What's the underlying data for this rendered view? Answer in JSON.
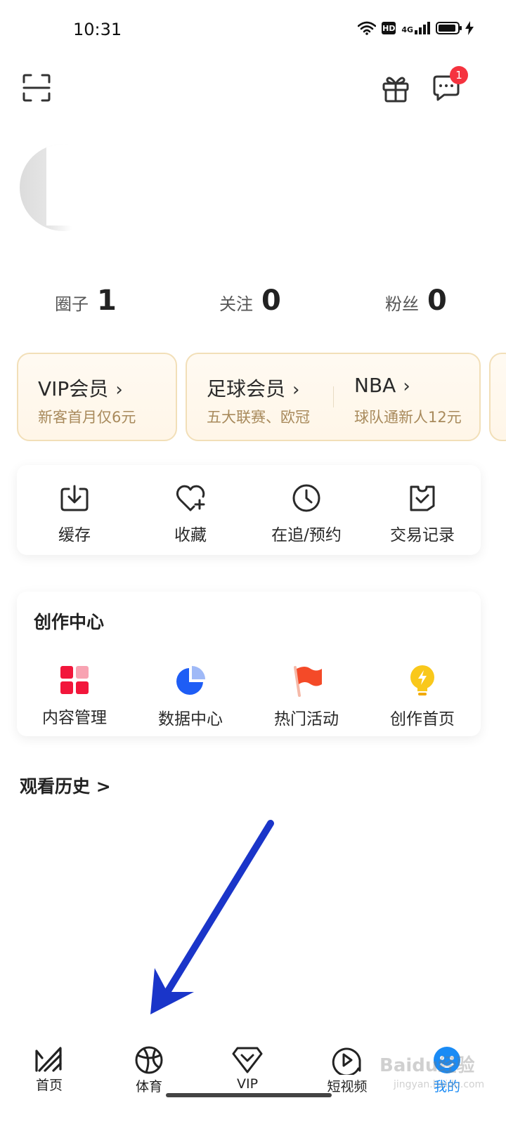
{
  "status_bar": {
    "time": "10:31",
    "hd": "HD",
    "network": "4G"
  },
  "header": {
    "message_badge": "1"
  },
  "stats": [
    {
      "label": "圈子",
      "value": "1"
    },
    {
      "label": "关注",
      "value": "0"
    },
    {
      "label": "粉丝",
      "value": "0"
    }
  ],
  "membership": {
    "vip": {
      "title": "VIP会员",
      "subtitle": "新客首月仅6元"
    },
    "football": {
      "title": "足球会员",
      "subtitle": "五大联赛、欧冠"
    },
    "nba": {
      "title": "NBA",
      "subtitle": "球队通新人12元"
    }
  },
  "quick_actions": [
    {
      "label": "缓存",
      "icon": "download-icon"
    },
    {
      "label": "收藏",
      "icon": "heart-plus-icon"
    },
    {
      "label": "在追/预约",
      "icon": "clock-icon"
    },
    {
      "label": "交易记录",
      "icon": "receipt-check-icon"
    }
  ],
  "creator_center": {
    "title": "创作中心",
    "items": [
      {
        "label": "内容管理",
        "icon": "grid-icon"
      },
      {
        "label": "数据中心",
        "icon": "pie-chart-icon"
      },
      {
        "label": "热门活动",
        "icon": "flag-icon"
      },
      {
        "label": "创作首页",
        "icon": "lightbulb-icon"
      }
    ]
  },
  "history": {
    "title": "观看历史 >"
  },
  "bottom_nav": [
    {
      "label": "首页",
      "icon": "home-logo-icon"
    },
    {
      "label": "体育",
      "icon": "basketball-icon"
    },
    {
      "label": "VIP",
      "icon": "vip-shield-icon"
    },
    {
      "label": "短视频",
      "icon": "play-bubble-icon"
    },
    {
      "label": "我的",
      "icon": "avatar-face-icon",
      "active": true
    }
  ],
  "colors": {
    "accent": "#1a8bf5",
    "badge": "#f5333f",
    "arrow": "#1a35c9",
    "card_border": "#f2dfb8"
  },
  "watermark": {
    "text": "Baidu经验",
    "sub": "jingyan.baidu.com"
  }
}
